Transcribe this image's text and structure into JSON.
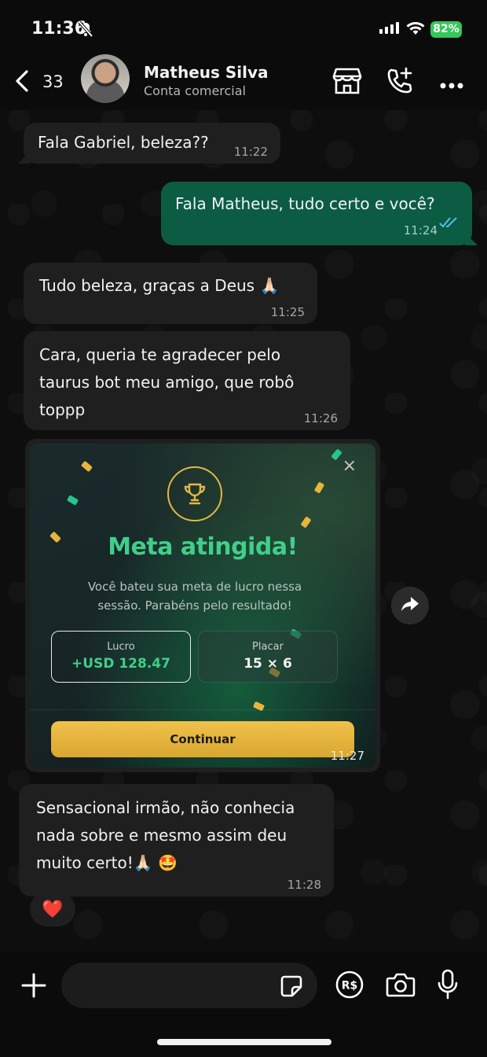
{
  "status_bar": {
    "time": "11:36",
    "battery": "82%"
  },
  "header": {
    "back_count": "33",
    "contact_name": "Matheus Silva",
    "contact_subtitle": "Conta comercial",
    "icons": [
      "store-icon",
      "call-add-icon",
      "more-icon"
    ]
  },
  "messages": [
    {
      "direction": "in",
      "text": "Fala Gabriel, beleza??",
      "time": "11:22"
    },
    {
      "direction": "out",
      "text": "Fala Matheus, tudo certo e você?",
      "time": "11:24",
      "status": "read"
    },
    {
      "direction": "in",
      "text": "Tudo beleza, graças a Deus",
      "emoji": "🙏🏻",
      "time": "11:25"
    },
    {
      "direction": "in",
      "text_lines": [
        "Cara, queria te agradecer pelo",
        "taurus bot meu amigo, que robô",
        "toppp"
      ],
      "time": "11:26"
    },
    {
      "direction": "in",
      "type": "image",
      "time": "11:27",
      "card": {
        "title": "Meta atingida!",
        "description_lines": [
          "Você bateu sua meta de lucro nessa",
          "sessão. Parabéns pelo resultado!"
        ],
        "stats": [
          {
            "label": "Lucro",
            "value": "+USD 128.47"
          },
          {
            "label": "Placar",
            "value": "15 × 6"
          }
        ],
        "button": "Continuar",
        "close": "×"
      }
    },
    {
      "direction": "in",
      "text_lines": [
        "Sensacional irmão, não conhecia",
        "nada sobre e mesmo assim deu",
        "muito certo!"
      ],
      "emoji": "🙏🏻 🤩",
      "time": "11:28",
      "reaction": "❤️"
    }
  ],
  "composer": {
    "value": "",
    "icons": [
      "plus-icon",
      "sticker-icon",
      "payment-icon",
      "camera-icon",
      "microphone-icon"
    ],
    "payment_label": "R$"
  },
  "colors": {
    "incoming_bubble": "#1f1f1f",
    "outgoing_bubble": "#0b5c43",
    "accent_green": "#3fcf8a",
    "button_gold": "#f0c14b",
    "read_ticks": "#53bdeb"
  }
}
